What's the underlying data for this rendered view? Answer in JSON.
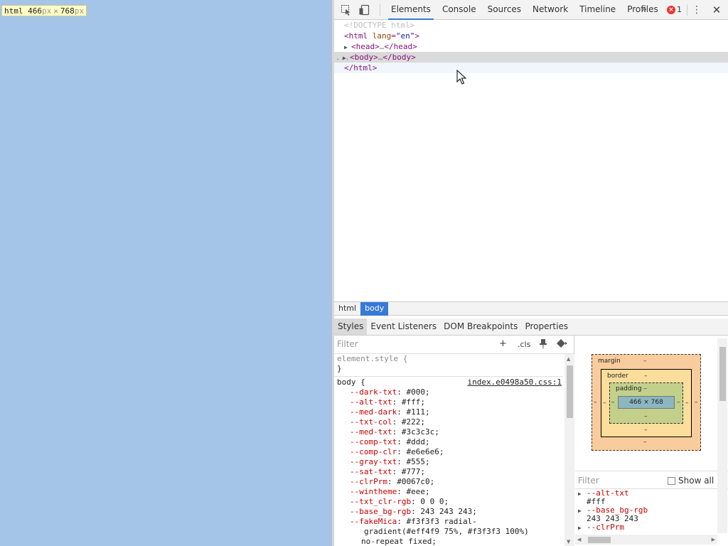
{
  "viewport": {
    "tooltip": {
      "tag": "html",
      "width": "466",
      "unit": "px",
      "times": "×",
      "height": "768"
    }
  },
  "toolbar": {
    "tabs": [
      "Elements",
      "Console",
      "Sources",
      "Network",
      "Timeline",
      "Profiles"
    ],
    "active_tab": "Elements",
    "more_label": "»",
    "error_count": "1",
    "error_icon": "×",
    "menu_label": "⋮",
    "close_label": "✕"
  },
  "dom": {
    "doctype": "<!DOCTYPE html>",
    "html_open_tag": "<html",
    "html_attr_name": "lang",
    "html_attr_value": "\"en\"",
    "html_open_end": ">",
    "head_open": "<head>",
    "head_dots": "…",
    "head_close": "</head>",
    "body_open": "<body>",
    "body_dots": "…",
    "body_close": "</body>",
    "html_close": "</html>",
    "selected_marker": "..."
  },
  "breadcrumb": [
    "html",
    "body"
  ],
  "lower_tabs": [
    "Styles",
    "Event Listeners",
    "DOM Breakpoints",
    "Properties"
  ],
  "styles": {
    "filter_placeholder": "Filter",
    "add_rule": "+",
    "cls_label": ".cls",
    "element_style_open": "element.style {",
    "element_style_close": "}",
    "body_selector": "body {",
    "source_link": "index.e0498a50.css:1",
    "properties": [
      {
        "name": "--dark-txt",
        "value": "#000;"
      },
      {
        "name": "--alt-txt",
        "value": "#fff;"
      },
      {
        "name": "--med-dark",
        "value": "#111;"
      },
      {
        "name": "--txt-col",
        "value": "#222;"
      },
      {
        "name": "--med-txt",
        "value": "#3c3c3c;"
      },
      {
        "name": "--comp-txt",
        "value": "#ddd;"
      },
      {
        "name": "--comp-clr",
        "value": "#e6e6e6;"
      },
      {
        "name": "--gray-txt",
        "value": "#555;"
      },
      {
        "name": "--sat-txt",
        "value": "#777;"
      },
      {
        "name": "--clrPrm",
        "value": "#0067c0;"
      },
      {
        "name": "--wintheme",
        "value": "#eee;"
      },
      {
        "name": "--txt_clr-rgb",
        "value": "0 0 0;"
      },
      {
        "name": "--base_bg-rgb",
        "value": "243 243 243;"
      },
      {
        "name": "--fakeMica",
        "value": "#f3f3f3 radial-"
      }
    ],
    "fakemica_cont1": "gradient(#eff4f9 75%, #f3f3f3 100%)",
    "fakemica_cont2": "no-repeat fixed;",
    "closing_brace": "}"
  },
  "box_model": {
    "margin_label": "margin",
    "margin_value": "–",
    "border_label": "border",
    "border_value": "–",
    "padding_label": "padding –",
    "content": "466 × 768",
    "dash": "–"
  },
  "computed": {
    "filter_placeholder": "Filter",
    "show_all_label": "Show all",
    "items": [
      {
        "name": "--alt-txt",
        "value": "#fff"
      },
      {
        "name": "--base_bg-rgb",
        "value": "243 243 243"
      },
      {
        "name": "--clrPrm",
        "value": ""
      }
    ]
  }
}
